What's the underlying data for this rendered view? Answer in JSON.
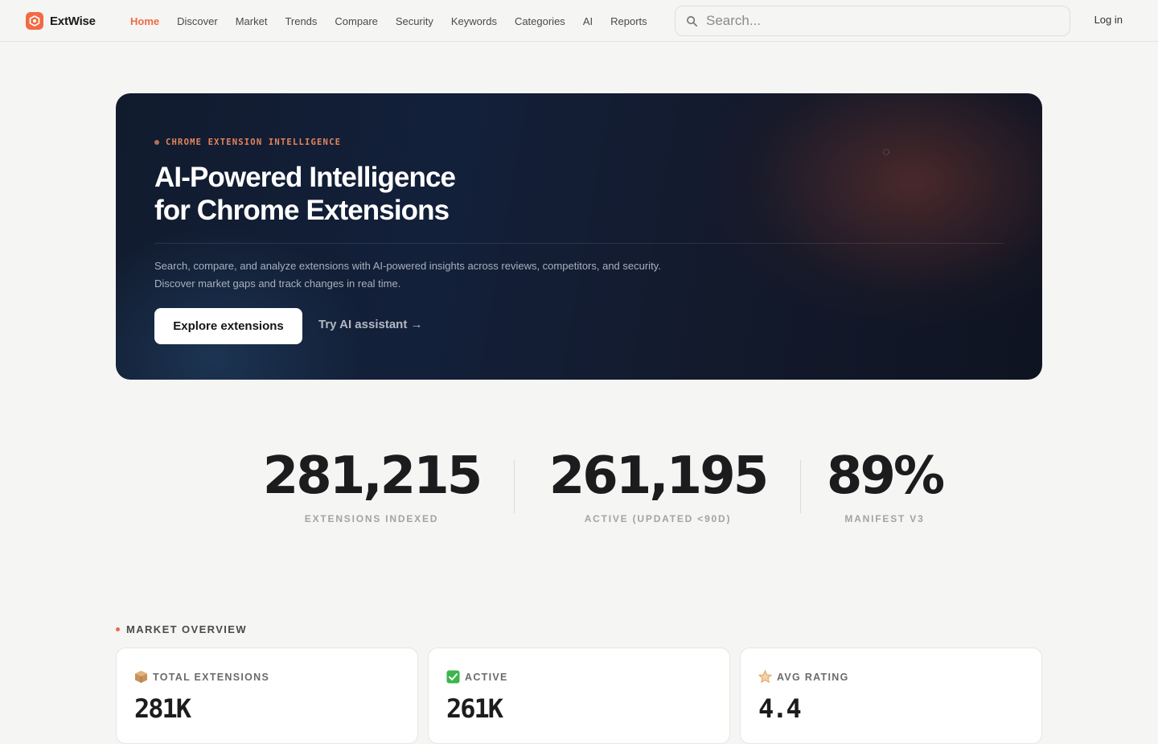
{
  "brand": {
    "name": "ExtWise",
    "accent": "#ef6a43"
  },
  "nav": {
    "items": [
      {
        "label": "Home",
        "active": true
      },
      {
        "label": "Discover"
      },
      {
        "label": "Market"
      },
      {
        "label": "Trends"
      },
      {
        "label": "Compare"
      },
      {
        "label": "Security"
      },
      {
        "label": "Keywords"
      },
      {
        "label": "Categories"
      },
      {
        "label": "AI"
      },
      {
        "label": "Reports"
      }
    ],
    "search_placeholder": "Search...",
    "login_label": "Log in"
  },
  "hero": {
    "eyebrow": "CHROME EXTENSION INTELLIGENCE",
    "title_line1": "AI-Powered Intelligence",
    "title_line2": "for Chrome Extensions",
    "description": "Search, compare, and analyze extensions with AI-powered insights across reviews, competitors, and security. Discover market gaps and track changes in real time.",
    "primary_button": "Explore extensions",
    "secondary_link": "Try AI assistant →"
  },
  "stats": [
    {
      "value": "281,215",
      "label": "EXTENSIONS INDEXED"
    },
    {
      "value": "261,195",
      "label": "ACTIVE (UPDATED <90D)"
    },
    {
      "value": "89%",
      "label": "MANIFEST V3"
    }
  ],
  "market_overview": {
    "title": "MARKET OVERVIEW",
    "cards": [
      {
        "icon": "package-icon",
        "label": "TOTAL EXTENSIONS",
        "value": "281K"
      },
      {
        "icon": "check-icon",
        "label": "ACTIVE",
        "value": "261K"
      },
      {
        "icon": "star-icon",
        "label": "AVG RATING",
        "value": "4.4"
      }
    ]
  }
}
